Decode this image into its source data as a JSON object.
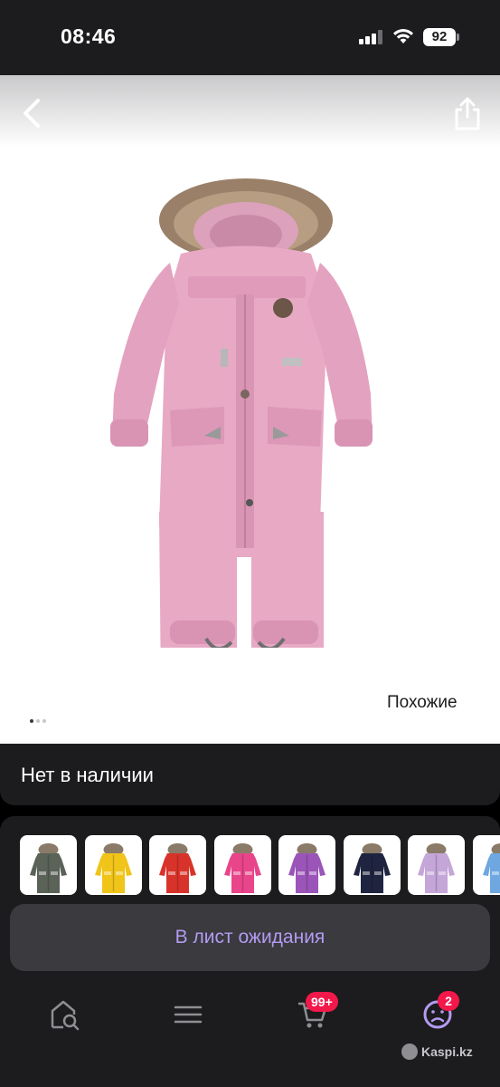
{
  "status_bar": {
    "time": "08:46",
    "battery": "92"
  },
  "header": {
    "back_icon": "chevron-left-icon",
    "share_icon": "share-icon"
  },
  "gallery": {
    "similar_label": "Похожие",
    "dots_count": 3,
    "active_dot": 0
  },
  "availability": {
    "text": "Нет в наличии"
  },
  "variants": {
    "thumb_colors": [
      "#5b6258",
      "#f0c419",
      "#d8332a",
      "#e8458a",
      "#9b55b8",
      "#1f2540",
      "#c4a6d8",
      "#6fa7e0"
    ]
  },
  "actions": {
    "waitlist_label": "В лист ожидания"
  },
  "bottom_nav": {
    "items": [
      "home-search-icon",
      "menu-icon",
      "cart-icon",
      "profile-icon"
    ],
    "cart_badge": "99+",
    "profile_badge": "2"
  },
  "watermark": "Kaspi.kz",
  "colors": {
    "accent": "#b39bf2",
    "badge": "#f2184a",
    "product": "#e7a9c4"
  }
}
